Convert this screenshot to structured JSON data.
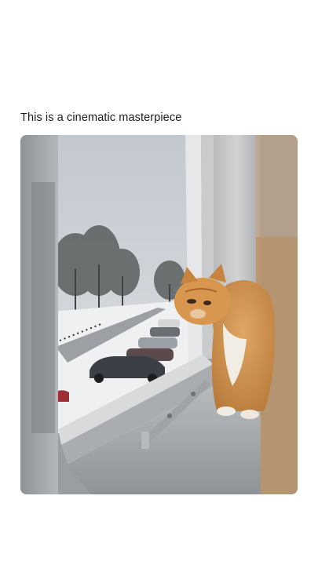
{
  "post": {
    "caption": "This is a cinematic masterpiece"
  },
  "media": {
    "kind": "video-still",
    "subject": "orange cat on window sill looking at snowy street"
  },
  "colors": {
    "background": "#ffffff",
    "caption_text": "#1a1a1a",
    "cat_orange": "#d99a55",
    "sky": "#c8ccd2"
  }
}
